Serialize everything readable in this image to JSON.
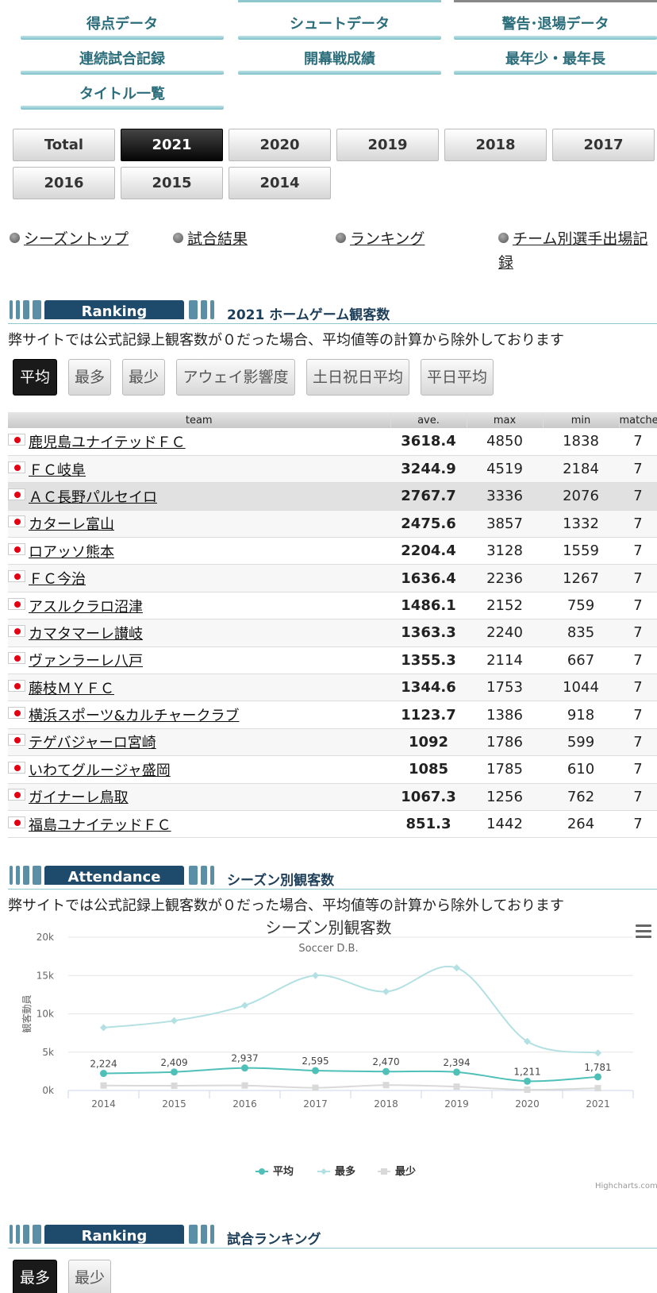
{
  "topnav": {
    "links": [
      "得点データ",
      "シュートデータ",
      "警告･退場データ",
      "連続試合記録",
      "開幕戦成績",
      "最年少・最年長",
      "タイトル一覧"
    ]
  },
  "years": {
    "buttons": [
      "Total",
      "2021",
      "2020",
      "2019",
      "2018",
      "2017",
      "2016",
      "2015",
      "2014"
    ],
    "active": "2021"
  },
  "subnav": {
    "links": [
      "シーズントップ",
      "試合結果",
      "ランキング",
      "チーム別選手出場記録"
    ]
  },
  "ranking_section": {
    "badge": "Ranking",
    "title": "2021 ホームゲーム観客数",
    "note": "弊サイトでは公式記録上観客数が０だった場合、平均値等の計算から除外しております"
  },
  "filter_tabs": [
    "平均",
    "最多",
    "最少",
    "アウェイ影響度",
    "土日祝日平均",
    "平日平均"
  ],
  "table": {
    "headers": [
      "team",
      "ave.",
      "max",
      "min",
      "matches"
    ],
    "rows": [
      {
        "team": "鹿児島ユナイテッドＦＣ",
        "ave": "3618.4",
        "max": "4850",
        "min": "1838",
        "matches": "7"
      },
      {
        "team": "ＦＣ岐阜",
        "ave": "3244.9",
        "max": "4519",
        "min": "2184",
        "matches": "7"
      },
      {
        "team": "ＡＣ長野パルセイロ",
        "ave": "2767.7",
        "max": "3336",
        "min": "2076",
        "matches": "7"
      },
      {
        "team": "カターレ富山",
        "ave": "2475.6",
        "max": "3857",
        "min": "1332",
        "matches": "7"
      },
      {
        "team": "ロアッソ熊本",
        "ave": "2204.4",
        "max": "3128",
        "min": "1559",
        "matches": "7"
      },
      {
        "team": "ＦＣ今治",
        "ave": "1636.4",
        "max": "2236",
        "min": "1267",
        "matches": "7"
      },
      {
        "team": "アスルクラロ沼津",
        "ave": "1486.1",
        "max": "2152",
        "min": "759",
        "matches": "7"
      },
      {
        "team": "カマタマーレ讃岐",
        "ave": "1363.3",
        "max": "2240",
        "min": "835",
        "matches": "7"
      },
      {
        "team": "ヴァンラーレ八戸",
        "ave": "1355.3",
        "max": "2114",
        "min": "667",
        "matches": "7"
      },
      {
        "team": "藤枝ＭＹＦＣ",
        "ave": "1344.6",
        "max": "1753",
        "min": "1044",
        "matches": "7"
      },
      {
        "team": "横浜スポーツ&カルチャークラブ",
        "ave": "1123.7",
        "max": "1386",
        "min": "918",
        "matches": "7"
      },
      {
        "team": "テゲバジャーロ宮崎",
        "ave": "1092",
        "max": "1786",
        "min": "599",
        "matches": "7"
      },
      {
        "team": "いわてグルージャ盛岡",
        "ave": "1085",
        "max": "1785",
        "min": "610",
        "matches": "7"
      },
      {
        "team": "ガイナーレ鳥取",
        "ave": "1067.3",
        "max": "1256",
        "min": "762",
        "matches": "7"
      },
      {
        "team": "福島ユナイテッドＦＣ",
        "ave": "851.3",
        "max": "1442",
        "min": "264",
        "matches": "7"
      }
    ]
  },
  "attendance_section": {
    "badge": "Attendance",
    "title": "シーズン別観客数",
    "note": "弊サイトでは公式記録上観客数が０だった場合、平均値等の計算から除外しております"
  },
  "chart_data": {
    "type": "line",
    "title": "シーズン別観客数",
    "subtitle": "Soccer D.B.",
    "ylabel": "観客動員",
    "xlabel": "",
    "categories": [
      "2014",
      "2015",
      "2016",
      "2017",
      "2018",
      "2019",
      "2020",
      "2021"
    ],
    "ylim": [
      0,
      20000
    ],
    "yticks": [
      "0k",
      "5k",
      "10k",
      "15k",
      "20k"
    ],
    "grid": true,
    "legend": "bottom-center",
    "credits": "Highcharts.com",
    "series": [
      {
        "name": "平均",
        "values": [
          2224,
          2409,
          2937,
          2595,
          2470,
          2394,
          1211,
          1781
        ],
        "labels": [
          "2,224",
          "2,409",
          "2,937",
          "2,595",
          "2,470",
          "2,394",
          "1,211",
          "1,781"
        ],
        "color": "#4ec0b8",
        "marker": "circle"
      },
      {
        "name": "最多",
        "values": [
          8200,
          9100,
          11100,
          15000,
          12900,
          16000,
          6400,
          4900
        ],
        "color": "#b3e0e3",
        "marker": "diamond"
      },
      {
        "name": "最少",
        "values": [
          650,
          620,
          650,
          350,
          700,
          500,
          100,
          300
        ],
        "color": "#d9d9d9",
        "marker": "square"
      }
    ]
  },
  "match_ranking_section": {
    "badge": "Ranking",
    "title": "試合ランキング"
  },
  "bottom_tabs": [
    "最多",
    "最少"
  ]
}
